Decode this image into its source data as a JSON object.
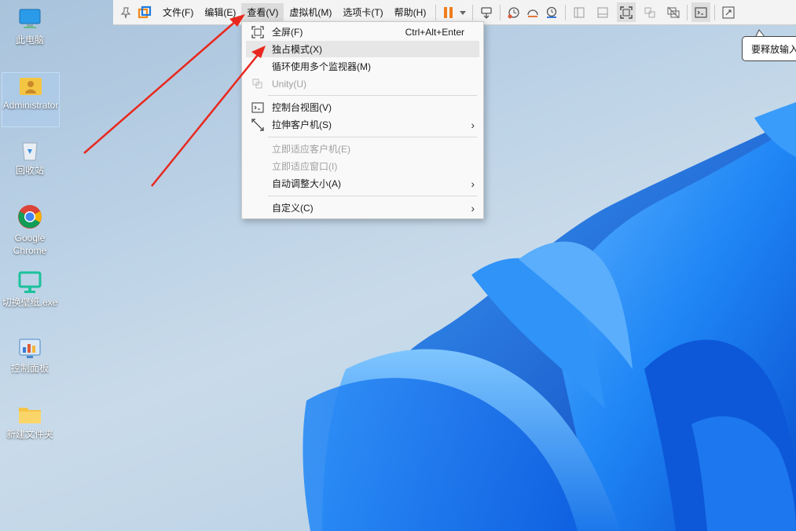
{
  "desktop": {
    "icons": [
      {
        "label": "此电脑",
        "icon": "computer-icon"
      },
      {
        "label": "Administrator",
        "icon": "user-folder-icon"
      },
      {
        "label": "回收站",
        "icon": "recycle-bin-icon"
      },
      {
        "label": "Google Chrome",
        "icon": "chrome-icon"
      },
      {
        "label": "切换壁纸.exe",
        "icon": "monitor-icon"
      },
      {
        "label": "控制面板",
        "icon": "control-panel-icon"
      },
      {
        "label": "新建文件夹",
        "icon": "folder-icon"
      }
    ]
  },
  "toolbar": {
    "menus": [
      {
        "label": "文件(F)"
      },
      {
        "label": "编辑(E)"
      },
      {
        "label": "查看(V)"
      },
      {
        "label": "虚拟机(M)"
      },
      {
        "label": "选项卡(T)"
      },
      {
        "label": "帮助(H)"
      }
    ],
    "icons": [
      "pin-icon",
      "vmware-logo-icon",
      "pause-icon",
      "dropdown-caret-icon",
      "send-keys-icon",
      "snapshot-icon",
      "revert-snapshot-icon",
      "snapshot-manager-icon",
      "sidebar-icon",
      "thumbnail-bar-icon",
      "fullscreen-icon",
      "unity-icon",
      "multi-monitor-icon",
      "console-view-icon",
      "stretch-icon"
    ],
    "pause_color": "#f07d1a"
  },
  "view_menu": {
    "items": [
      {
        "label": "全屏(F)",
        "shortcut": "Ctrl+Alt+Enter",
        "icon": "fullscreen-icon",
        "enabled": true
      },
      {
        "label": "独占模式(X)",
        "enabled": true,
        "highlighted": true
      },
      {
        "label": "循环使用多个监视器(M)",
        "enabled": true
      },
      {
        "label": "Unity(U)",
        "icon": "unity-icon",
        "enabled": false
      },
      {
        "label": "控制台视图(V)",
        "icon": "console-view-icon",
        "enabled": true
      },
      {
        "label": "拉伸客户机(S)",
        "icon": "stretch-icon",
        "submenu": true,
        "enabled": true
      },
      {
        "label": "立即适应客户机(E)",
        "enabled": false
      },
      {
        "label": "立即适应窗口(I)",
        "enabled": false
      },
      {
        "label": "自动调整大小(A)",
        "submenu": true,
        "enabled": true
      },
      {
        "label": "自定义(C)",
        "submenu": true,
        "enabled": true
      }
    ]
  },
  "tooltip": {
    "text": "要释放输入"
  },
  "colors": {
    "annotation_arrow": "#e8281e",
    "bloom_blue": "#1a7ff0"
  }
}
